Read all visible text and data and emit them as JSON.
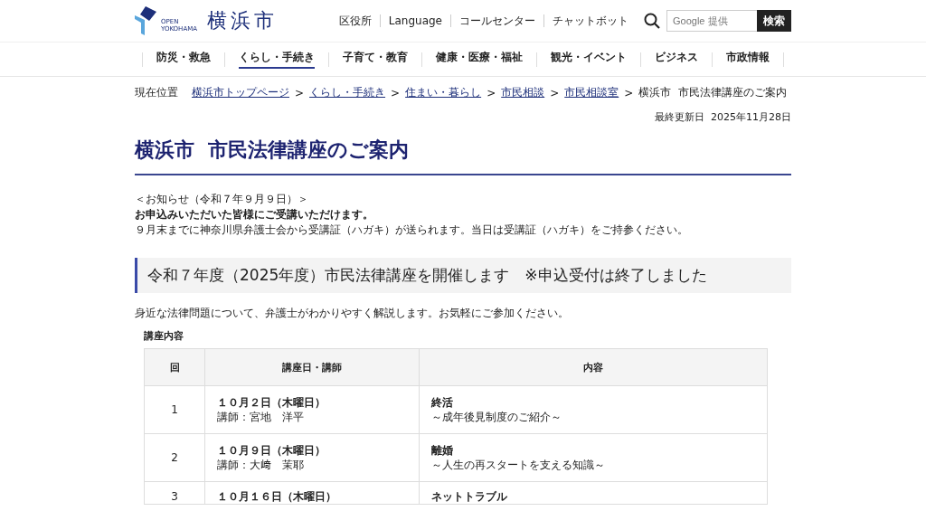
{
  "logo": {
    "tagline_top": "OPEN",
    "tagline_bottom": "YOKOHAMA",
    "name": "横浜市"
  },
  "utility_links": [
    "区役所",
    "Language",
    "コールセンター",
    "チャットボット"
  ],
  "search": {
    "placeholder": "Google 提供",
    "button": "検索"
  },
  "nav": [
    {
      "label": "防災・救急",
      "selected": false
    },
    {
      "label": "くらし・手続き",
      "selected": true
    },
    {
      "label": "子育て・教育",
      "selected": false
    },
    {
      "label": "健康・医療・福祉",
      "selected": false
    },
    {
      "label": "観光・イベント",
      "selected": false
    },
    {
      "label": "ビジネス",
      "selected": false
    },
    {
      "label": "市政情報",
      "selected": false
    }
  ],
  "breadcrumb": {
    "label": "現在位置",
    "links": [
      "横浜市トップページ",
      "くらし・手続き",
      "住まい・暮らし",
      "市民相談",
      "市民相談室"
    ],
    "separator": ">",
    "current": "横浜市  市民法律講座のご案内"
  },
  "updated": "最終更新日  2025年11月28日",
  "title": "横浜市  市民法律講座のご案内",
  "notice": [
    {
      "text": "＜お知らせ（令和７年９月９日）＞",
      "bold": false
    },
    {
      "text": "お申込みいただいた皆様にご受講いただけます。",
      "bold": true
    },
    {
      "text": "９月末までに神奈川県弁護士会から受講証（ハガキ）が送られます。当日は受講証（ハガキ）をご持参ください。",
      "bold": false
    }
  ],
  "section_heading": "令和７年度（2025年度）市民法律講座を開催します　※申込受付は終了しました",
  "intro": "身近な法律問題について、弁護士がわかりやすく解説します。お気軽にご参加ください。",
  "table": {
    "caption": "講座内容",
    "columns": [
      "回",
      "講座日・講師",
      "内容"
    ],
    "rows": [
      {
        "number": "1",
        "date": "１０月２日（木曜日）",
        "lecturer": "講師：宮地　洋平",
        "topic": "終活",
        "subtitle": "～成年後見制度のご紹介～"
      },
      {
        "number": "2",
        "date": "１０月９日（木曜日）",
        "lecturer": "講師：大﨑　茉耶",
        "topic": "離婚",
        "subtitle": "～人生の再スタートを支える知識～"
      },
      {
        "number": "3",
        "date": "１０月１６日（木曜日）",
        "topic": "ネットトラブル"
      }
    ]
  }
}
